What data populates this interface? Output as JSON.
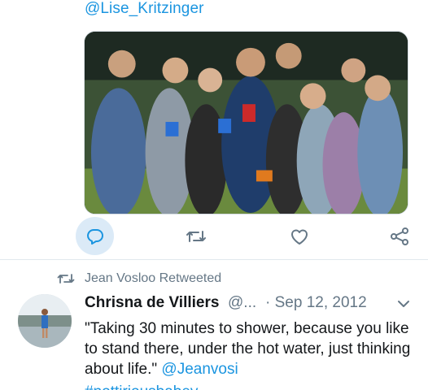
{
  "previous_tweet": {
    "mention": "@Lise_Kritzinger",
    "actions": {
      "reply_icon": "reply-icon",
      "retweet_icon": "retweet-icon",
      "like_icon": "heart-icon",
      "share_icon": "share-icon"
    }
  },
  "retweet_banner": {
    "text": "Jean Vosloo Retweeted"
  },
  "tweet": {
    "name": "Chrisna de Villiers",
    "handle": "@...",
    "date": "· Sep 12, 2012",
    "text_before": "\"Taking 30 minutes to shower, because you like to stand there, under the hot water, just thinking about life.\" ",
    "mention": "@Jeanvosi",
    "hashtag": "#nottiriousbabey"
  },
  "colors": {
    "link": "#1b95e0",
    "secondary_text": "#657786",
    "reply_highlight": "#dbeaf7"
  }
}
